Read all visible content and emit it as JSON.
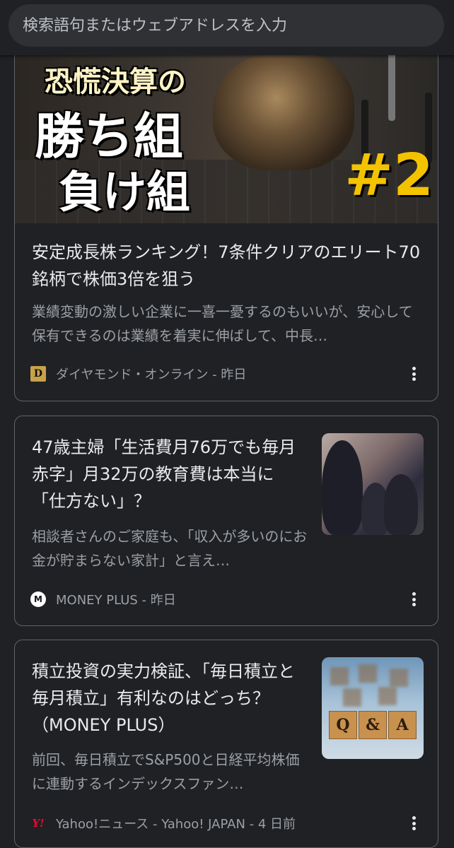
{
  "search": {
    "placeholder": "検索語句またはウェブアドレスを入力"
  },
  "cards": [
    {
      "hero": {
        "line1": "恐慌決算の",
        "line2": "勝ち組",
        "line3": "負け組",
        "number": "#2"
      },
      "title": "安定成長株ランキング！7条件クリアのエリート70銘柄で株価3倍を狙う",
      "snippet": "業績変動の激しい企業に一喜一憂するのもいいが、安心して保有できるのは業績を着実に伸ばして、中長…",
      "source": "ダイヤモンド・オンライン - 昨日",
      "favicon_text": "D",
      "favicon_icon": "diamond-online-favicon"
    },
    {
      "title": "47歳主婦「生活費月76万でも毎月赤字」月32万の教育費は本当に「仕方ない」？",
      "snippet": "相談者さんのご家庭も、「収入が多いのにお金が貯まらない家計」と言え…",
      "source": "MONEY PLUS - 昨日",
      "favicon_text": "M",
      "favicon_icon": "money-plus-favicon",
      "thumbnail": "students-classroom-thumbnail"
    },
    {
      "title": "積立投資の実力検証、「毎日積立と毎月積立」有利なのはどっち？（MONEY PLUS）",
      "snippet": "前回、毎日積立でS&P500と日経平均株価に連動するインデックスファン…",
      "source": "Yahoo!ニュース - Yahoo! JAPAN - 4 日前",
      "favicon_text": "Y!",
      "favicon_icon": "yahoo-favicon",
      "thumbnail": "qa-wooden-blocks-thumbnail",
      "thumb_letters": [
        "Q",
        "&",
        "A"
      ]
    }
  ]
}
